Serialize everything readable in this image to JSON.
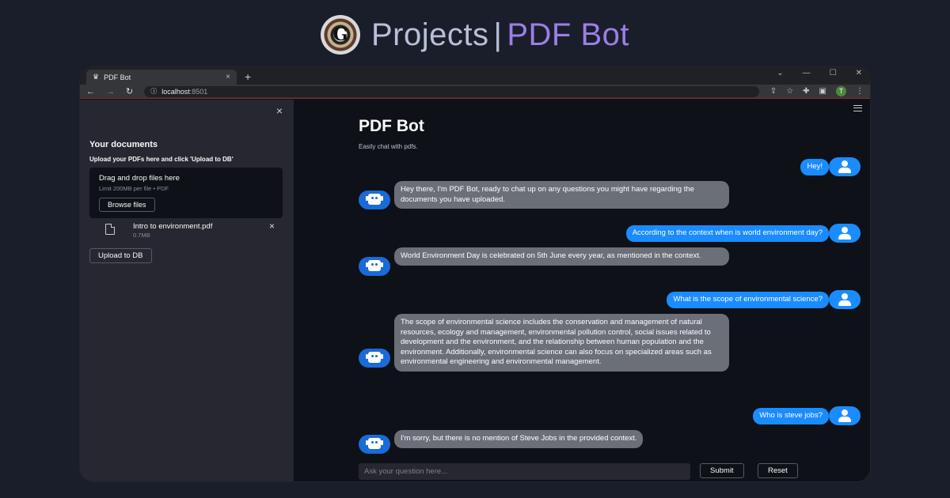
{
  "banner": {
    "logo_letter": "G",
    "title_part1": "Projects",
    "separator": "|",
    "title_part2": "PDF Bot"
  },
  "browser": {
    "tab_title": "PDF Bot",
    "tab_close": "×",
    "new_tab": "+",
    "url_host": "localhost",
    "url_port": ":8501",
    "profile_initial": "T"
  },
  "sidebar": {
    "close": "×",
    "title": "Your documents",
    "instructions": "Upload your PDFs here and click 'Upload to DB'",
    "dropzone_title": "Drag and drop files here",
    "dropzone_limit": "Limit 200MB per file • PDF",
    "browse_label": "Browse files",
    "file_name": "Intro to environment.pdf",
    "file_size": "0.7MB",
    "file_remove": "×",
    "upload_label": "Upload to DB"
  },
  "main": {
    "title": "PDF Bot",
    "subtitle": "Easily chat with pdfs.",
    "messages": [
      {
        "role": "user",
        "text": "Hey!"
      },
      {
        "role": "bot",
        "text": "Hey there, I'm PDF Bot, ready to chat up on any questions you might have regarding the documents you have uploaded."
      },
      {
        "role": "user",
        "text": "According to the context when is world environment day?"
      },
      {
        "role": "bot",
        "text": "World Environment Day is celebrated on 5th June every year, as mentioned in the context."
      },
      {
        "role": "user",
        "text": "What is the scope of environmental science?"
      },
      {
        "role": "bot",
        "text": "The scope of environmental science includes the conservation and management of natural resources, ecology and management, environmental pollution control, social issues related to development and the environment, and the relationship between human population and the environment. Additionally, environmental science can also focus on specialized areas such as environmental engineering and environmental management."
      },
      {
        "role": "user",
        "text": "Who is steve jobs?"
      },
      {
        "role": "bot",
        "text": "I'm sorry, but there is no mention of Steve Jobs in the provided context."
      }
    ],
    "input_placeholder": "Ask your question here...",
    "submit_label": "Submit",
    "reset_label": "Reset"
  },
  "colors": {
    "user_bubble": "#1a8cff",
    "bot_bubble": "#6b6f78",
    "accent_purple": "#9c7ee8",
    "sidebar_bg": "#262730",
    "main_bg": "#0e1117"
  }
}
